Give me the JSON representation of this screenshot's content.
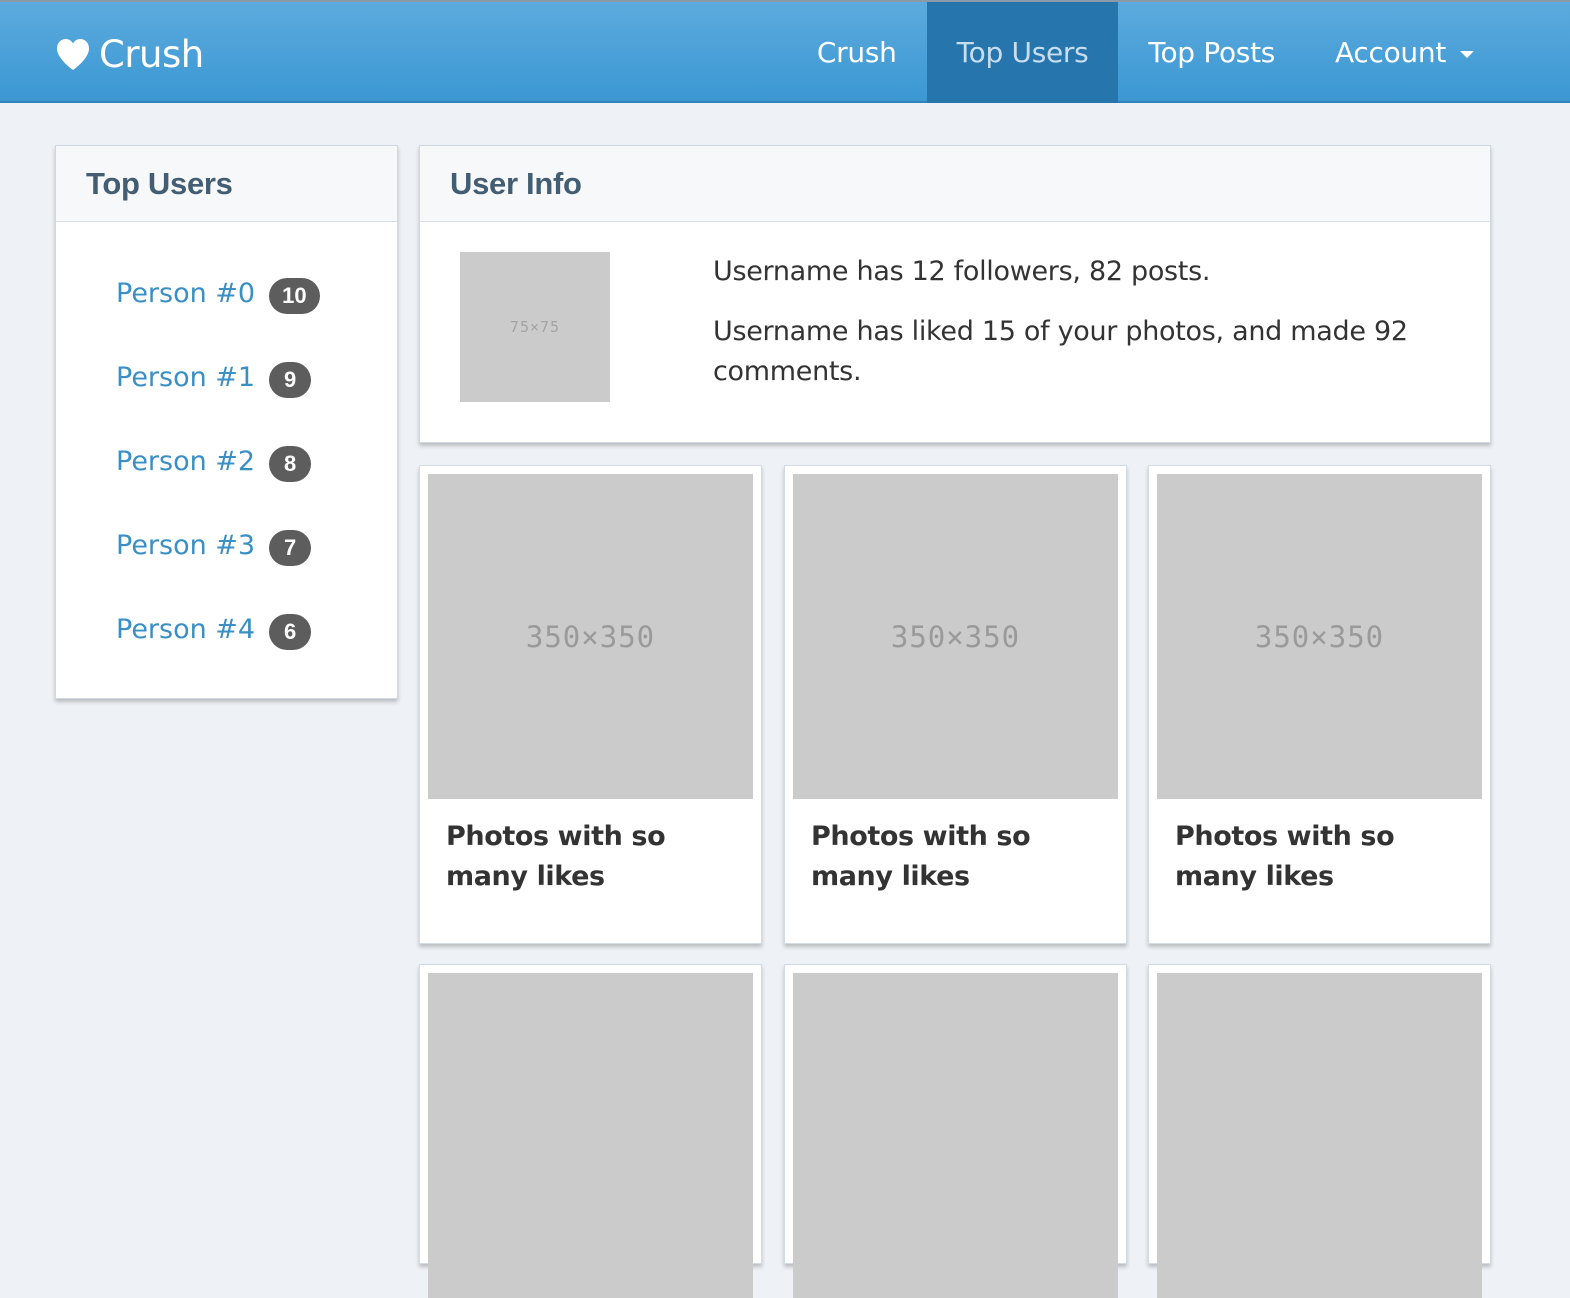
{
  "navbar": {
    "brand_icon": "heart-icon",
    "brand": "Crush",
    "items": [
      {
        "label": "Crush",
        "active": false
      },
      {
        "label": "Top Users",
        "active": true
      },
      {
        "label": "Top Posts",
        "active": false
      },
      {
        "label": "Account",
        "active": false,
        "dropdown": true
      }
    ]
  },
  "top_users": {
    "title": "Top Users",
    "users": [
      {
        "name": "Person #0",
        "count": "10"
      },
      {
        "name": "Person #1",
        "count": "9"
      },
      {
        "name": "Person #2",
        "count": "8"
      },
      {
        "name": "Person #3",
        "count": "7"
      },
      {
        "name": "Person #4",
        "count": "6"
      }
    ]
  },
  "user_info": {
    "title": "User Info",
    "avatar_placeholder": "75×75",
    "line1": "Username has 12 followers, 82 posts.",
    "line2": "Username has liked 15 of your photos, and made 92 comments."
  },
  "photos": [
    {
      "placeholder": "350×350",
      "caption": "Photos with so many likes"
    },
    {
      "placeholder": "350×350",
      "caption": "Photos with so many likes"
    },
    {
      "placeholder": "350×350",
      "caption": "Photos with so many likes"
    },
    {
      "placeholder": "",
      "caption": ""
    },
    {
      "placeholder": "",
      "caption": ""
    },
    {
      "placeholder": "",
      "caption": ""
    }
  ],
  "colors": {
    "navbar_top": "#5cabdd",
    "navbar_bottom": "#3b97d3",
    "nav_active": "#2676ad",
    "link": "#3a8fc4",
    "badge": "#5d5d5d",
    "panel_title": "#435d73",
    "placeholder": "#cbcbcb"
  }
}
